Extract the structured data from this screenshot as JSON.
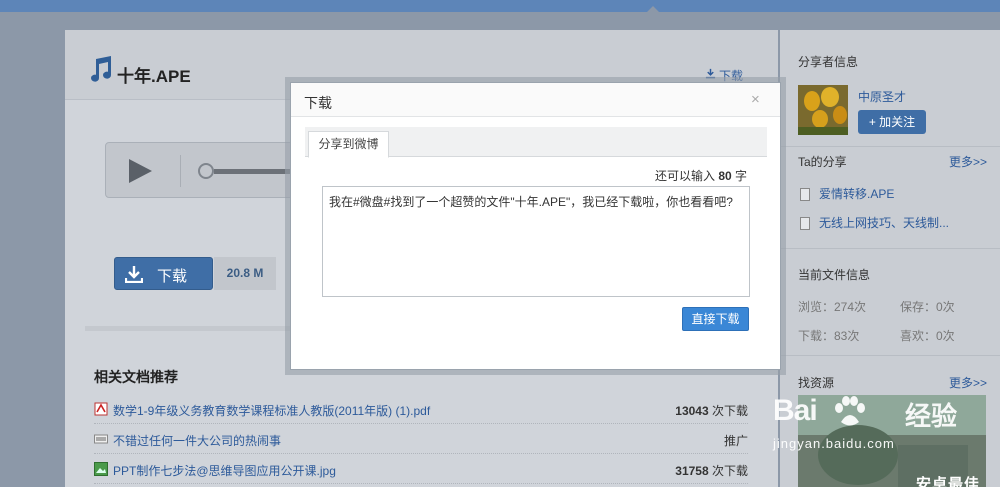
{
  "file": {
    "title": "十年.APE",
    "download_link": "下载",
    "download_button": "下载",
    "size": "20.8 M"
  },
  "related": {
    "title": "相关文档推荐",
    "items": [
      {
        "name": "数学1-9年级义务教育数学课程标准人教版(2011年版) (1).pdf",
        "count": "13043",
        "suffix": " 次下载",
        "icon": "pdf-icon"
      },
      {
        "name": "不错过任何一件大公司的热闹事",
        "count": "",
        "suffix": "推广",
        "icon": "ad-icon"
      },
      {
        "name": "PPT制作七步法@思维导图应用公开课.jpg",
        "count": "31758",
        "suffix": " 次下载",
        "icon": "image-icon"
      }
    ]
  },
  "sidebar": {
    "sharer_heading": "分享者信息",
    "sharer_name": "中原圣才",
    "follow_label": "+ 加关注",
    "shares_heading": "Ta的分享",
    "more_label": "更多>>",
    "shares": [
      "爱情转移.APE",
      "无线上网技巧、天线制..."
    ],
    "fileinfo_heading": "当前文件信息",
    "stats": {
      "views": "浏览：274次",
      "saves": "保存：0次",
      "downloads": "下载：83次",
      "likes": "喜欢：0次"
    },
    "resources_heading": "找资源",
    "resources_more": "更多>>",
    "promo_text": "安卓最佳"
  },
  "modal": {
    "title": "下载",
    "close": "×",
    "tab_label": "分享到微博",
    "remain_prefix": "还可以输入 ",
    "remain_count": "80",
    "remain_suffix": " 字",
    "message": "我在#微盘#找到了一个超赞的文件\"十年.APE\"，我已经下载啦，你也看看吧?",
    "direct_download": "直接下载"
  },
  "watermark": {
    "brand": "Bai",
    "brand2": "经验",
    "url": "jingyan.baidu.com"
  },
  "colors": {
    "accent": "#3f6ea6",
    "link": "#2d5a9a",
    "button_blue": "#3a87d6"
  }
}
